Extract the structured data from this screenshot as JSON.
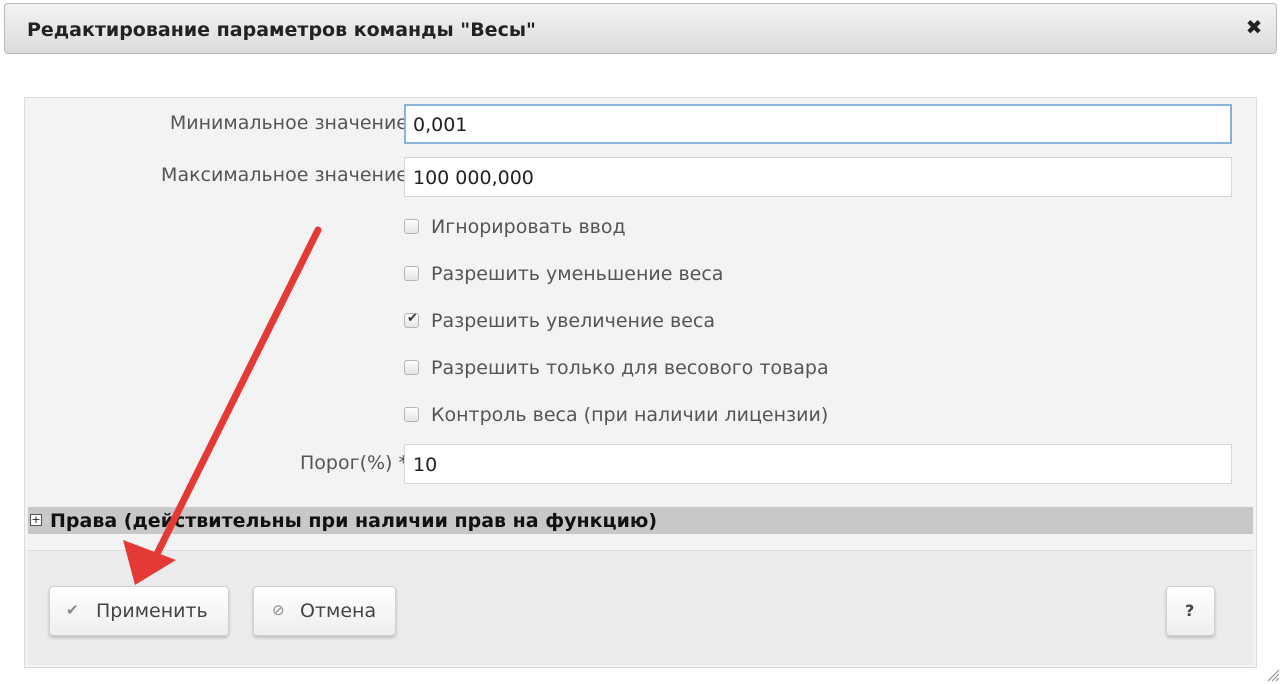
{
  "dialog": {
    "title": "Редактирование параметров команды \"Весы\"",
    "close_glyph": "✖"
  },
  "form": {
    "min_label": "Минимальное значение",
    "min_value": "0,001",
    "max_label": "Максимальное значение",
    "max_value": "100 000,000",
    "threshold_label": "Порог(%) *",
    "threshold_value": "10"
  },
  "checkboxes": [
    {
      "label": "Игнорировать ввод",
      "checked": false
    },
    {
      "label": "Разрешить уменьшение веса",
      "checked": false
    },
    {
      "label": "Разрешить увеличение веса",
      "checked": true
    },
    {
      "label": "Разрешить только для весового товара",
      "checked": false
    },
    {
      "label": "Контроль веса (при наличии лицензии)",
      "checked": false
    }
  ],
  "rights": {
    "expand_glyph": "+",
    "title": "Права (действительны при наличии прав на функцию)"
  },
  "buttons": {
    "apply_label": "Применить",
    "apply_icon": "check-icon",
    "cancel_label": "Отмена",
    "cancel_icon": "ban-icon",
    "help_label": "?"
  },
  "colors": {
    "arrow": "#e53935",
    "focus_border": "#8bb2dc"
  }
}
